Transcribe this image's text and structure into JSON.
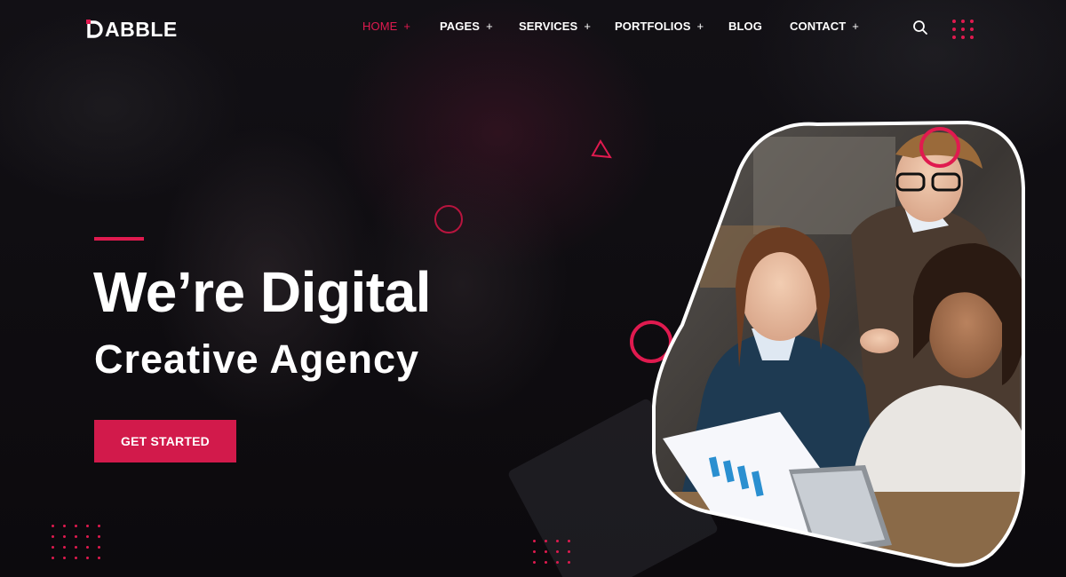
{
  "brand": {
    "logo_text": "ABBLE",
    "logo_letter": "D"
  },
  "nav": {
    "items": [
      {
        "label": "HOME",
        "has_submenu": true,
        "active": true
      },
      {
        "label": "PAGES",
        "has_submenu": true,
        "active": false
      },
      {
        "label": "SERVICES",
        "has_submenu": true,
        "active": false
      },
      {
        "label": "PORTFOLIOS",
        "has_submenu": true,
        "active": false
      },
      {
        "label": "BLOG",
        "has_submenu": false,
        "active": false
      },
      {
        "label": "CONTACT",
        "has_submenu": true,
        "active": false
      }
    ],
    "submenu_marker": "+"
  },
  "icons": {
    "search": "search-icon",
    "menu": "dots-grid-menu-icon"
  },
  "hero": {
    "title": "We’re Digital",
    "subtitle": "Creative Agency",
    "cta_label": "GET STARTED"
  },
  "colors": {
    "accent": "#e01a4f",
    "button": "#d21a4b",
    "background": "#0d0b0e",
    "text": "#ffffff"
  }
}
